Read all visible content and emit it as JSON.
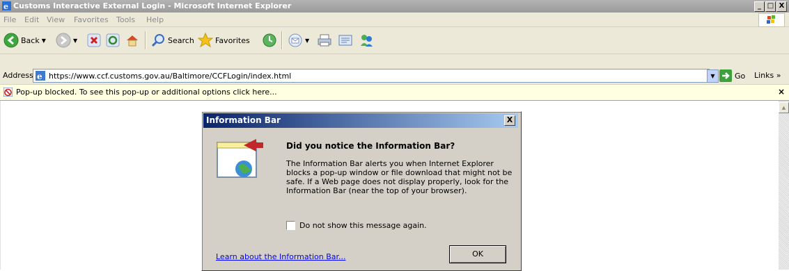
{
  "window": {
    "title": "Customs Interactive External Login - Microsoft Internet Explorer",
    "controls": {
      "minimize": "_",
      "maximize": "□",
      "close": "X"
    }
  },
  "menubar": {
    "items": [
      "File",
      "Edit",
      "View",
      "Favorites",
      "Tools",
      "Help"
    ]
  },
  "toolbar": {
    "back_label": "Back",
    "search_label": "Search",
    "favorites_label": "Favorites"
  },
  "addressbar": {
    "label": "Address",
    "url": "https://www.ccf.customs.gov.au/Baltimore/CCFLogin/index.html",
    "go_label": "Go",
    "links_label": "Links »"
  },
  "infobar": {
    "text": "Pop-up blocked. To see this pop-up or additional options click here...",
    "close": "×"
  },
  "dialog": {
    "title": "Information Bar",
    "close": "X",
    "heading": "Did you notice the Information Bar?",
    "body": "The Information Bar alerts you when Internet Explorer blocks a pop-up window or file download that might not be safe. If a Web page does not display properly, look for the Information Bar (near the top of your browser).",
    "checkbox_label": "Do not show this message again.",
    "checkbox_checked": false,
    "link_label": "Learn about the Information Bar...",
    "ok_label": "OK"
  },
  "colors": {
    "titlebar": "#a6a6a6",
    "infobar": "#ffffe1",
    "dialog_title_start": "#0a246a",
    "dialog_title_end": "#a6caf0",
    "chrome": "#ece9d8"
  }
}
